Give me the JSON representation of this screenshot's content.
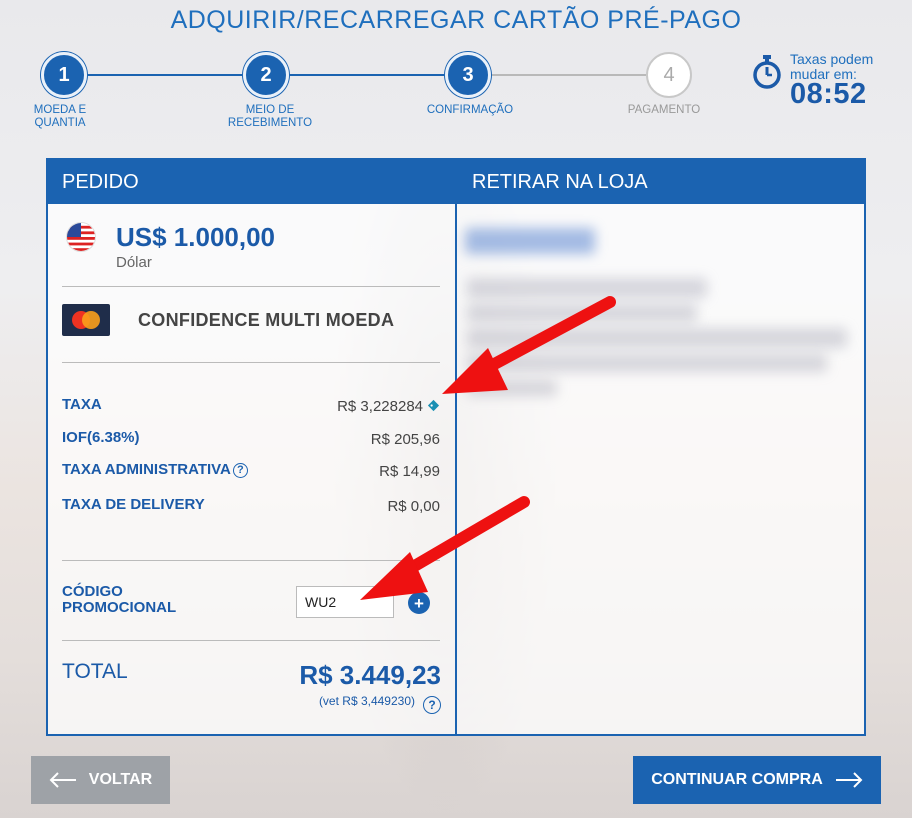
{
  "page": {
    "title": "ADQUIRIR/RECARREGAR CARTÃO PRÉ-PAGO"
  },
  "stepper": {
    "steps": [
      {
        "number": "1",
        "label": "MOEDA E QUANTIA",
        "state": "active"
      },
      {
        "number": "2",
        "label": "MEIO DE RECEBIMENTO",
        "state": "active"
      },
      {
        "number": "3",
        "label": "CONFIRMAÇÃO",
        "state": "active"
      },
      {
        "number": "4",
        "label": "PAGAMENTO",
        "state": "inactive"
      }
    ]
  },
  "timer": {
    "label": "Taxas podem mudar em:",
    "value": "08:52",
    "icon": "stopwatch-icon"
  },
  "order": {
    "header": "PEDIDO",
    "amount": "US$ 1.000,00",
    "currency_name": "Dólar",
    "currency_flag_icon": "us-flag-icon",
    "card_logo_icon": "mastercard-icon",
    "card_name": "CONFIDENCE MULTI MOEDA",
    "fees": [
      {
        "label": "TAXA",
        "value": "R$ 3,228284",
        "icon": "tag-icon"
      },
      {
        "label": "IOF(6.38%)",
        "value": "R$ 205,96"
      },
      {
        "label": "TAXA ADMINISTRATIVA",
        "value": "R$ 14,99",
        "icon": "help-icon"
      },
      {
        "label": "TAXA DE DELIVERY",
        "value": "R$ 0,00"
      }
    ],
    "promo": {
      "label": "CÓDIGO PROMOCIONAL",
      "value": "WU2",
      "add_label": "+"
    },
    "total": {
      "label": "TOTAL",
      "value": "R$ 3.449,23",
      "vet": "(vet R$ 3,449230)",
      "help": "?"
    }
  },
  "pickup": {
    "header": "RETIRAR NA LOJA"
  },
  "buttons": {
    "back_label": "VOLTAR",
    "continue_label": "CONTINUAR COMPRA"
  },
  "colors": {
    "primary": "#1b63b1",
    "annotation_arrow": "#ee1111",
    "back_button": "#9ea2a7"
  }
}
